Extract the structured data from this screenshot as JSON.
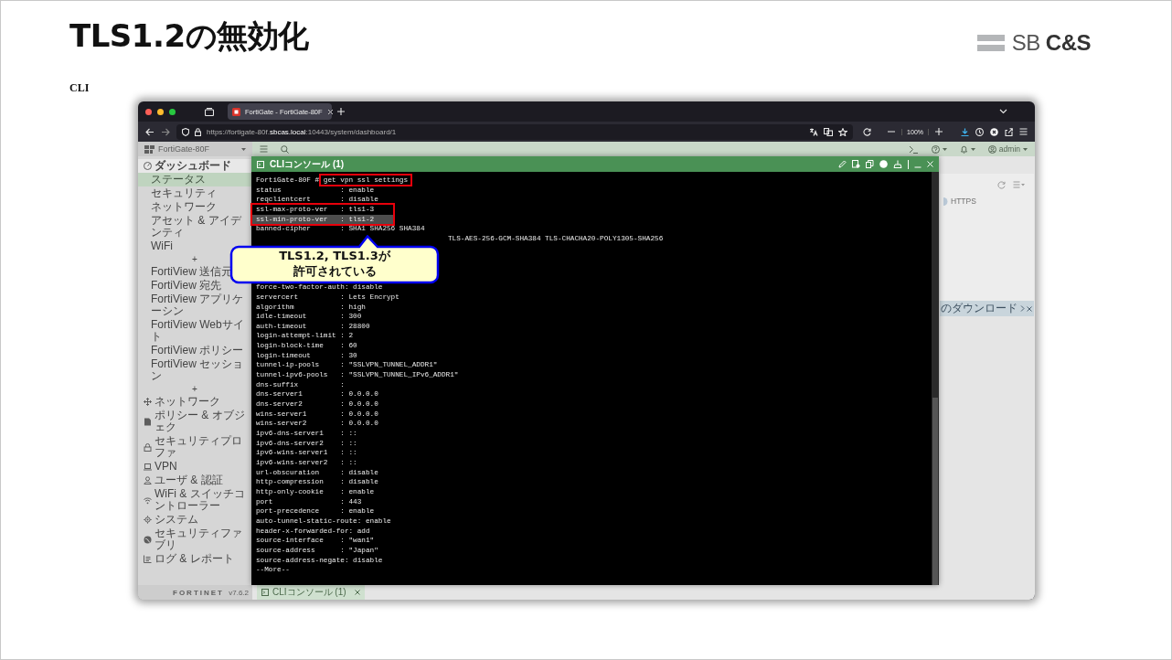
{
  "slide": {
    "title": "TLS1.2の無効化",
    "label": "CLI",
    "logo_text": "SB **C&S**"
  },
  "browser": {
    "tabs": [
      {
        "title": "FortiGate - FortiGate-80F",
        "selected": true
      }
    ],
    "url_prefix": "https://fortigate-80f.",
    "url_domain": "sbcas.local",
    "url_suffix": ":10443/system/dashboard/1",
    "zoom": "100%"
  },
  "fortigate": {
    "device": "FortiGate-80F",
    "user": "admin",
    "brand": "FORTINET",
    "version": "v7.6.2",
    "sidebar": [
      {
        "kind": "group",
        "label": "ダッシュボード",
        "expanded": true,
        "children": [
          {
            "kind": "item",
            "label": "ステータス",
            "selected": true
          },
          {
            "kind": "item",
            "label": "セキュリティ",
            "selected": false
          },
          {
            "kind": "item",
            "label": "ネットワーク",
            "selected": false
          },
          {
            "kind": "item",
            "label": "アセット & アイデンティ",
            "selected": false
          },
          {
            "kind": "item",
            "label": "WiFi",
            "selected": false
          },
          {
            "kind": "toggle",
            "label": "+"
          },
          {
            "kind": "item",
            "label": "FortiView 送信元",
            "selected": false
          },
          {
            "kind": "item",
            "label": "FortiView 宛先",
            "selected": false
          },
          {
            "kind": "item",
            "label": "FortiView アプリケーシン",
            "selected": false
          },
          {
            "kind": "item",
            "label": "FortiView Webサイト",
            "selected": false
          },
          {
            "kind": "item",
            "label": "FortiView ポリシー",
            "selected": false
          },
          {
            "kind": "item",
            "label": "FortiView セッション",
            "selected": false
          },
          {
            "kind": "toggle",
            "label": "+"
          }
        ]
      },
      {
        "kind": "section",
        "label": "ネットワーク"
      },
      {
        "kind": "section",
        "label": "ポリシー & オブジェク"
      },
      {
        "kind": "section",
        "label": "セキュリティプロファ"
      },
      {
        "kind": "section",
        "label": "VPN"
      },
      {
        "kind": "section",
        "label": "ユーザ & 認証"
      },
      {
        "kind": "section",
        "label": "WiFi & スイッチコントローラー"
      },
      {
        "kind": "section",
        "label": "システム"
      },
      {
        "kind": "section",
        "label": "セキュリティファブリ"
      },
      {
        "kind": "section",
        "label": "ログ & レポート"
      }
    ],
    "panel_label": "HTTPS",
    "download_bar": "のダウンロード",
    "bottom_tab": "CLIコンソール (1)"
  },
  "console": {
    "title": "CLIコンソール (1)",
    "prompt": "FortiGate-80F #",
    "command": "get vpn ssl settings",
    "command_framed": true,
    "lines": [
      {
        "kind": "line",
        "text": "status              : enable",
        "framed": false,
        "highlighted": false
      },
      {
        "kind": "line",
        "text": "reqclientcert       : disable",
        "framed": false,
        "highlighted": false
      },
      {
        "kind": "line",
        "text": "ssl-max-proto-ver   : tls1-3",
        "framed": true,
        "highlighted": false
      },
      {
        "kind": "line",
        "text": "ssl-min-proto-ver   : tls1-2",
        "framed": true,
        "highlighted": true
      },
      {
        "kind": "line",
        "text": "banned-cipher       : SHA1 SHA256 SHA384",
        "framed": false,
        "highlighted": false
      },
      {
        "kind": "partial",
        "text": "TLS-AES-256-GCM-SHA384 TLS-CHACHA20-POLY1305-SHA256",
        "framed": false,
        "highlighted": false
      },
      {
        "kind": "line",
        "text": "force-two-factor-auth: disable",
        "framed": false,
        "highlighted": false
      },
      {
        "kind": "line",
        "text": "servercert          : Lets Encrypt",
        "framed": false,
        "highlighted": false
      },
      {
        "kind": "line",
        "text": "algorithm           : high",
        "framed": false,
        "highlighted": false
      },
      {
        "kind": "line",
        "text": "idle-timeout        : 300",
        "framed": false,
        "highlighted": false
      },
      {
        "kind": "line",
        "text": "auth-timeout        : 28800",
        "framed": false,
        "highlighted": false
      },
      {
        "kind": "line",
        "text": "login-attempt-limit : 2",
        "framed": false,
        "highlighted": false
      },
      {
        "kind": "line",
        "text": "login-block-time    : 60",
        "framed": false,
        "highlighted": false
      },
      {
        "kind": "line",
        "text": "login-timeout       : 30",
        "framed": false,
        "highlighted": false
      },
      {
        "kind": "line",
        "text": "tunnel-ip-pools     : \"SSLVPN_TUNNEL_ADDR1\"",
        "framed": false,
        "highlighted": false
      },
      {
        "kind": "line",
        "text": "tunnel-ipv6-pools   : \"SSLVPN_TUNNEL_IPv6_ADDR1\"",
        "framed": false,
        "highlighted": false
      },
      {
        "kind": "line",
        "text": "dns-suffix          :",
        "framed": false,
        "highlighted": false
      },
      {
        "kind": "line",
        "text": "dns-server1         : 0.0.0.0",
        "framed": false,
        "highlighted": false
      },
      {
        "kind": "line",
        "text": "dns-server2         : 0.0.0.0",
        "framed": false,
        "highlighted": false
      },
      {
        "kind": "line",
        "text": "wins-server1        : 0.0.0.0",
        "framed": false,
        "highlighted": false
      },
      {
        "kind": "line",
        "text": "wins-server2        : 0.0.0.0",
        "framed": false,
        "highlighted": false
      },
      {
        "kind": "line",
        "text": "ipv6-dns-server1    : ::",
        "framed": false,
        "highlighted": false
      },
      {
        "kind": "line",
        "text": "ipv6-dns-server2    : ::",
        "framed": false,
        "highlighted": false
      },
      {
        "kind": "line",
        "text": "ipv6-wins-server1   : ::",
        "framed": false,
        "highlighted": false
      },
      {
        "kind": "line",
        "text": "ipv6-wins-server2   : ::",
        "framed": false,
        "highlighted": false
      },
      {
        "kind": "line",
        "text": "url-obscuration     : disable",
        "framed": false,
        "highlighted": false
      },
      {
        "kind": "line",
        "text": "http-compression    : disable",
        "framed": false,
        "highlighted": false
      },
      {
        "kind": "line",
        "text": "http-only-cookie    : enable",
        "framed": false,
        "highlighted": false
      },
      {
        "kind": "line",
        "text": "port                : 443",
        "framed": false,
        "highlighted": false
      },
      {
        "kind": "line",
        "text": "port-precedence     : enable",
        "framed": false,
        "highlighted": false
      },
      {
        "kind": "line",
        "text": "auto-tunnel-static-route: enable",
        "framed": false,
        "highlighted": false
      },
      {
        "kind": "line",
        "text": "header-x-forwarded-for: add",
        "framed": false,
        "highlighted": false
      },
      {
        "kind": "line",
        "text": "source-interface    : \"wan1\"",
        "framed": false,
        "highlighted": false
      },
      {
        "kind": "line",
        "text": "source-address      : \"Japan\"",
        "framed": false,
        "highlighted": false
      },
      {
        "kind": "line",
        "text": "source-address-negate: disable",
        "framed": false,
        "highlighted": false
      },
      {
        "kind": "line",
        "text": "--More--",
        "framed": false,
        "highlighted": false
      }
    ]
  },
  "callout": {
    "lines": [
      "TLS1.2, TLS1.3が",
      "許可されている"
    ]
  }
}
